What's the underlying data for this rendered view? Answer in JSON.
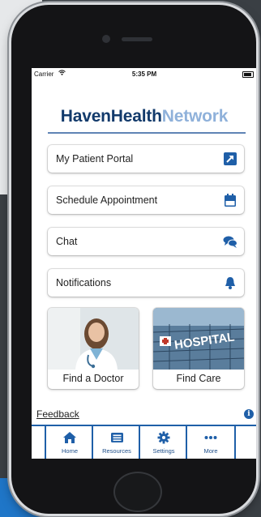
{
  "status": {
    "carrier": "Carrier",
    "time": "5:35 PM"
  },
  "logo": {
    "part1": "Haven",
    "part2": "Health",
    "part3": "Network"
  },
  "menu": [
    {
      "label": "My Patient Portal",
      "icon": "external-link-icon"
    },
    {
      "label": "Schedule Appointment",
      "icon": "calendar-icon"
    },
    {
      "label": "Chat",
      "icon": "chat-bubbles-icon"
    },
    {
      "label": "Notifications",
      "icon": "bell-icon"
    }
  ],
  "cards": [
    {
      "label": "Find a Doctor",
      "image": "doctor-photo"
    },
    {
      "label": "Find Care",
      "image": "hospital-photo",
      "sign_text": "HOSPITAL"
    }
  ],
  "feedback": {
    "label": "Feedback",
    "info_icon": "info-icon"
  },
  "tabs": [
    {
      "label": "Home",
      "icon": "home-icon"
    },
    {
      "label": "Resources",
      "icon": "newspaper-icon"
    },
    {
      "label": "Settings",
      "icon": "gear-icon"
    },
    {
      "label": "More",
      "icon": "more-dots-icon"
    }
  ],
  "colors": {
    "brand_dark": "#123a6b",
    "brand_light": "#8fb1da",
    "accent": "#1f5fa8"
  }
}
